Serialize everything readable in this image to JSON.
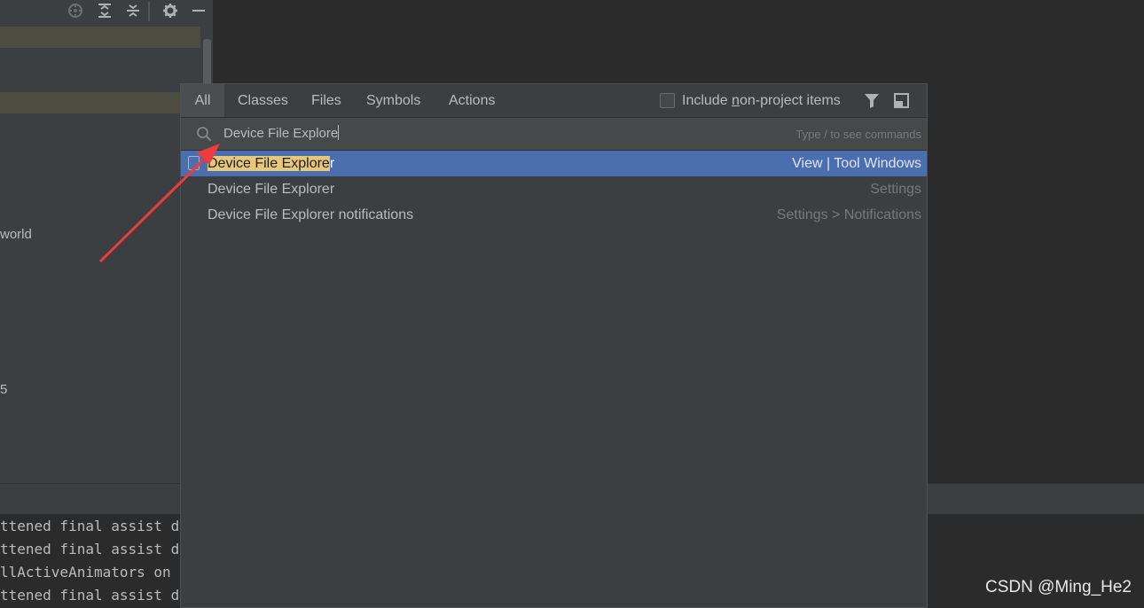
{
  "left_panel": {
    "tree_text_1": "world",
    "tree_text_2": "5"
  },
  "toolbar_icons": [
    "locate-icon",
    "expand-all-icon",
    "collapse-all-icon",
    "gear-icon",
    "minimize-icon"
  ],
  "console": {
    "lines": [
      "ttened final assist d",
      "ttened final assist d",
      "llActiveAnimators on",
      "ttened final assist d"
    ]
  },
  "popup": {
    "tabs": [
      "All",
      "Classes",
      "Files",
      "Symbols",
      "Actions"
    ],
    "active_tab": "All",
    "include_label_prefix": "Include ",
    "include_label_underlined": "n",
    "include_label_suffix": "on-project items",
    "include_checked": false,
    "search": {
      "value": "Device File Explore",
      "hint": "Type / to see commands"
    },
    "results": [
      {
        "name_highlight": "Device File Explore",
        "name_rest": "r",
        "category": "View | Tool Windows",
        "selected": true
      },
      {
        "name": "Device File Explorer",
        "category": "Settings"
      },
      {
        "name": "Device File Explorer notifications",
        "category": "Settings > Notifications"
      }
    ]
  },
  "watermark": "CSDN @Ming_He2",
  "colors": {
    "selection": "#4b6eaf",
    "match_highlight": "#e7c87b",
    "annotation_arrow": "#ee3b3b"
  }
}
